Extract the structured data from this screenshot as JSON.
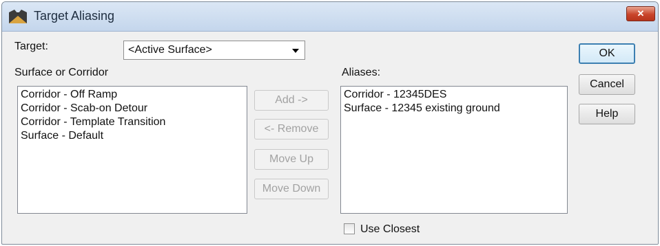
{
  "window": {
    "title": "Target Aliasing",
    "close_label": "✕"
  },
  "target": {
    "label": "Target:",
    "selected": "<Active Surface>"
  },
  "source_list": {
    "label": "Surface or Corridor",
    "items": [
      "Corridor - Off Ramp",
      "Corridor - Scab-on Detour",
      "Corridor - Template Transition",
      "Surface - Default"
    ]
  },
  "middle_buttons": {
    "add": "Add ->",
    "remove": "<- Remove",
    "move_up": "Move Up",
    "move_down": "Move Down"
  },
  "aliases": {
    "label": "Aliases:",
    "items": [
      "Corridor - 12345DES",
      "Surface - 12345 existing ground"
    ]
  },
  "options": {
    "use_closest_label": "Use Closest",
    "use_closest_checked": false
  },
  "actions": {
    "ok": "OK",
    "cancel": "Cancel",
    "help": "Help"
  }
}
